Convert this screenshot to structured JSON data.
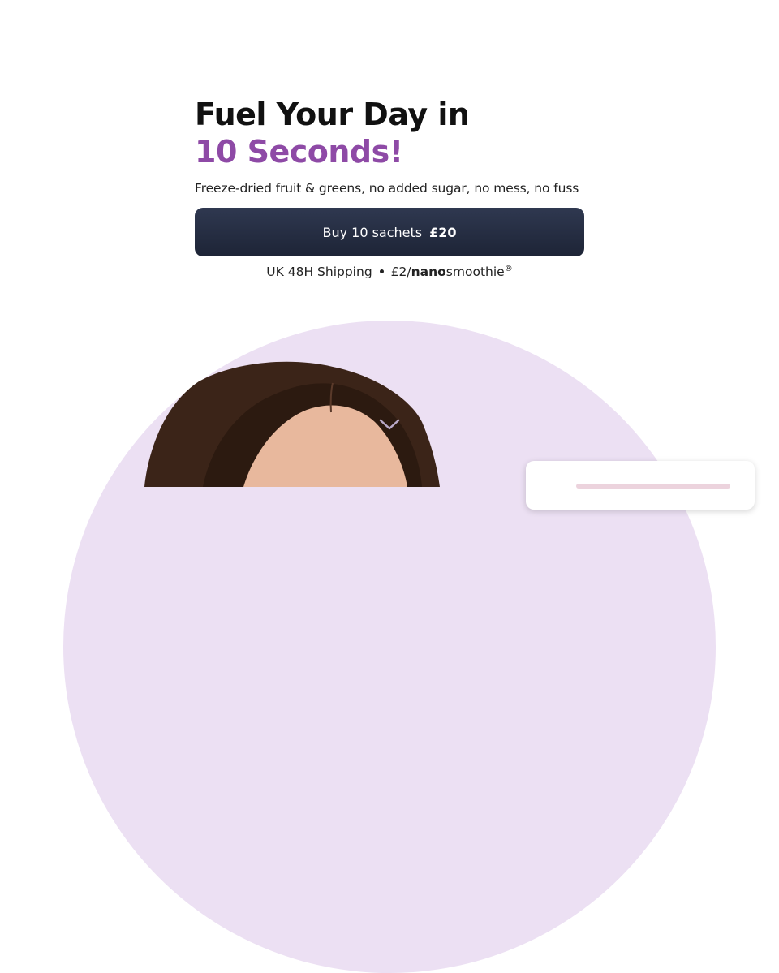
{
  "hero": {
    "headline_line1": "Fuel Your Day in",
    "headline_line2": "10 Seconds!",
    "subheadline": "Freeze-dried fruit & greens, no added sugar, no mess, no fuss",
    "buy_button": {
      "label": "Buy 10 sachets",
      "price": "£20"
    },
    "shipping": {
      "text": "UK 48H Shipping",
      "price_prefix": "£2/",
      "brand_bold": "nano",
      "brand_rest": "smoothie",
      "reg_mark": "®"
    }
  },
  "icons": {
    "scroll_down": "chevron-down-icon"
  },
  "colors": {
    "headline_accent": "#8e4aa6",
    "button_bg": "#252c40",
    "circle_bg": "#ece0f3"
  }
}
